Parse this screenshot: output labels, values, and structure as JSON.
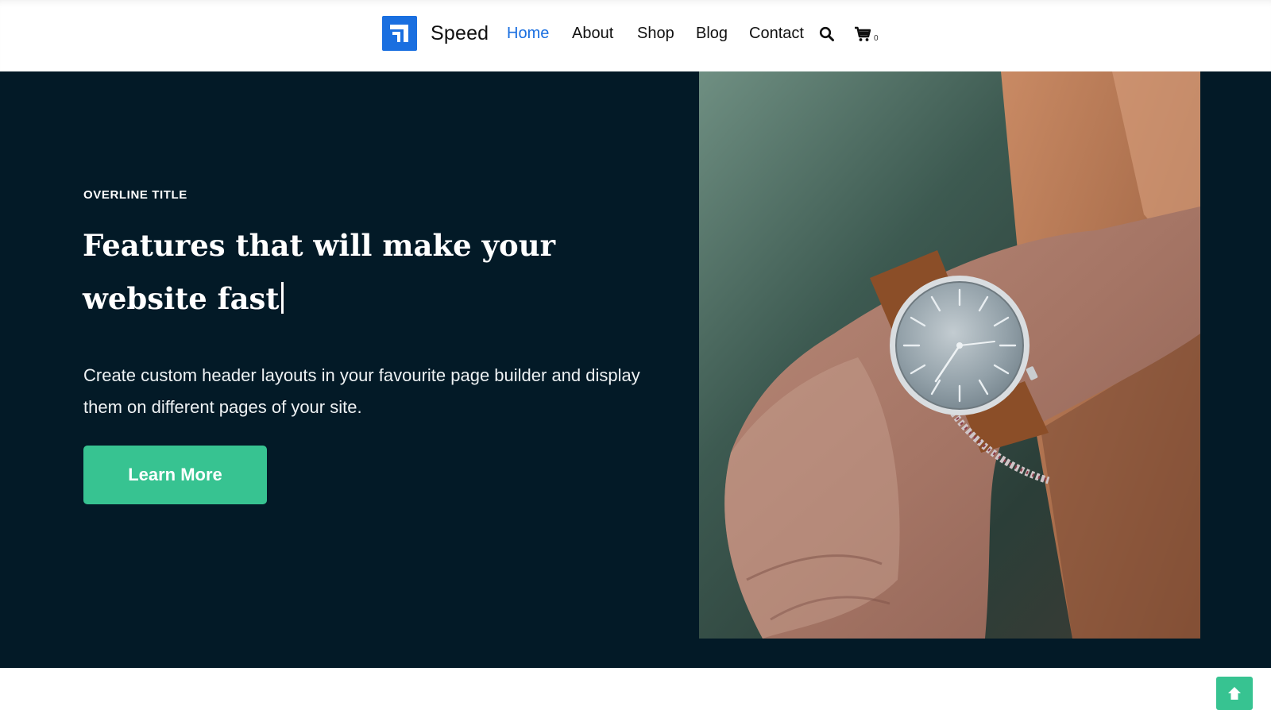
{
  "header": {
    "brand": "Speed",
    "nav": [
      {
        "label": "Home",
        "active": true
      },
      {
        "label": "About",
        "active": false
      },
      {
        "label": "Shop",
        "active": false
      },
      {
        "label": "Blog",
        "active": false
      },
      {
        "label": "Contact",
        "active": false
      }
    ],
    "search_icon": "search-icon",
    "cart_icon": "cart-icon",
    "cart_count": "0"
  },
  "hero": {
    "overline": "OVERLINE TITLE",
    "title": "Features that will make your website fast",
    "description": "Create custom header layouts in your favourite page builder and display them on different pages of your site.",
    "cta_label": "Learn More",
    "image_icon": "wristwatch-photo"
  },
  "scroll_top_icon": "arrow-up-icon",
  "colors": {
    "brand_blue": "#1a6fe0",
    "hero_background": "#031a27",
    "accent_green": "#37c391",
    "header_background": "#ffffff"
  }
}
